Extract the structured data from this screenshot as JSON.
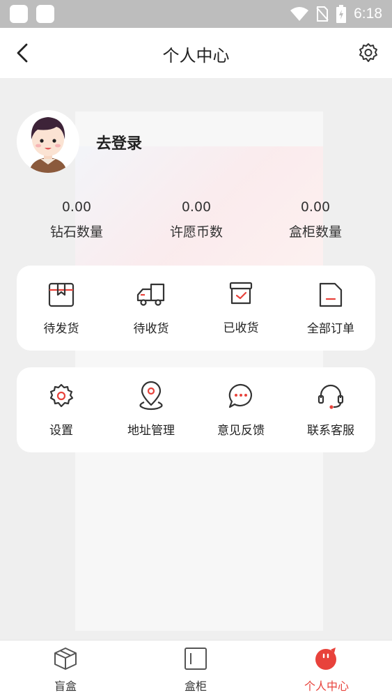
{
  "status_bar": {
    "time": "6:18"
  },
  "header": {
    "title": "个人中心"
  },
  "profile": {
    "login_label": "去登录"
  },
  "stats": [
    {
      "value": "0.00",
      "label": "钻石数量"
    },
    {
      "value": "0.00",
      "label": "许愿币数"
    },
    {
      "value": "0.00",
      "label": "盒柜数量"
    }
  ],
  "orders": [
    {
      "label": "待发货",
      "icon": "package-icon"
    },
    {
      "label": "待收货",
      "icon": "truck-icon"
    },
    {
      "label": "已收货",
      "icon": "box-check-icon"
    },
    {
      "label": "全部订单",
      "icon": "document-icon"
    }
  ],
  "services": [
    {
      "label": "设置",
      "icon": "gear-icon"
    },
    {
      "label": "地址管理",
      "icon": "location-pin-icon"
    },
    {
      "label": "意见反馈",
      "icon": "chat-bubble-icon"
    },
    {
      "label": "联系客服",
      "icon": "headset-icon"
    }
  ],
  "tabbar": [
    {
      "label": "盲盒",
      "icon": "cube-icon",
      "active": false
    },
    {
      "label": "盒柜",
      "icon": "cabinet-icon",
      "active": false
    },
    {
      "label": "个人中心",
      "icon": "profile-face-icon",
      "active": true
    }
  ],
  "colors": {
    "accent": "#e8423b",
    "status_bar": "#bdbdbd",
    "background": "#efefef"
  }
}
